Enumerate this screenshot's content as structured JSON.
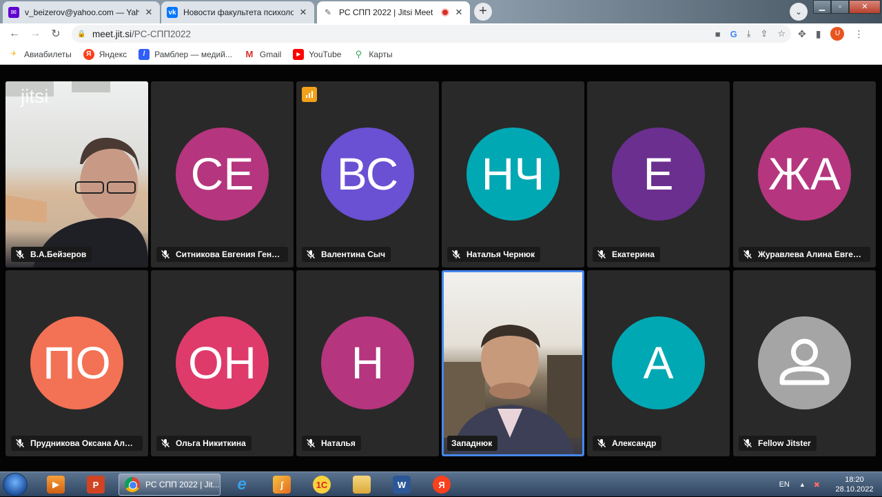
{
  "browser": {
    "tabs": [
      {
        "title": "v_beizerov@yahoo.com — Yahoo",
        "icon": "yahoo-mail-icon",
        "color": "#6001d2"
      },
      {
        "title": "Новости факультета психологии",
        "icon": "vk-icon",
        "color": "#0077ff"
      },
      {
        "title": "РС СПП 2022 | Jitsi Meet",
        "icon": "jitsi-icon",
        "color": "#5f6368"
      }
    ],
    "close_glyph": "✕",
    "new_tab_glyph": "+",
    "url_host": "meet.jit.si",
    "url_path": "/РС-СПП2022",
    "profile_initial": "U",
    "bookmarks": [
      {
        "label": "Авиабилеты",
        "icon": "plane-icon"
      },
      {
        "label": "Яндекс",
        "icon": "yandex-icon"
      },
      {
        "label": "Рамблер — медий...",
        "icon": "rambler-icon"
      },
      {
        "label": "Gmail",
        "icon": "gmail-icon"
      },
      {
        "label": "YouTube",
        "icon": "youtube-icon"
      },
      {
        "label": "Карты",
        "icon": "maps-pin-icon"
      }
    ]
  },
  "meeting": {
    "watermark": "jitsi",
    "tiles": [
      {
        "name": "В.А.Бейзеров",
        "type": "video",
        "muted": true
      },
      {
        "name": "Ситникова Евгения Генна...",
        "initials": "СЕ",
        "color": "#b5357e",
        "muted": true
      },
      {
        "name": "Валентина Сыч",
        "initials": "ВС",
        "color": "#6a50d3",
        "muted": true,
        "stats_badge": true
      },
      {
        "name": "Наталья Чернюк",
        "initials": "НЧ",
        "color": "#00a8b3",
        "muted": true
      },
      {
        "name": "Екатерина",
        "initials": "Е",
        "color": "#6b2f8f",
        "muted": true
      },
      {
        "name": "Журавлева Алина Евгень...",
        "initials": "ЖА",
        "color": "#b5357e",
        "muted": true
      },
      {
        "name": "Прудникова Оксана Алекс...",
        "initials": "ПО",
        "color": "#f37155",
        "muted": true
      },
      {
        "name": "Ольга Никиткина",
        "initials": "ОН",
        "color": "#de3b6a",
        "muted": true
      },
      {
        "name": "Наталья",
        "initials": "Н",
        "color": "#b5357e",
        "muted": true
      },
      {
        "name": "Западнюк",
        "type": "video",
        "muted": false,
        "active_speaker": true
      },
      {
        "name": "Александр",
        "initials": "А",
        "color": "#00a8b3",
        "muted": true
      },
      {
        "name": "Fellow Jitster",
        "initials": "",
        "color": "#a5a5a5",
        "muted": true,
        "placeholder_avatar": true
      }
    ]
  },
  "taskbar": {
    "chrome_task_label": "РС СПП 2022 | Jit...",
    "office_label": "1С",
    "word_label": "W",
    "yandex_label": "Я",
    "lang": "EN",
    "time": "18:20",
    "date": "28.10.2022"
  },
  "colors": {
    "active_speaker_border": "#4687ed",
    "tile_bg": "#292929",
    "stats_badge": "#f1a01b"
  }
}
